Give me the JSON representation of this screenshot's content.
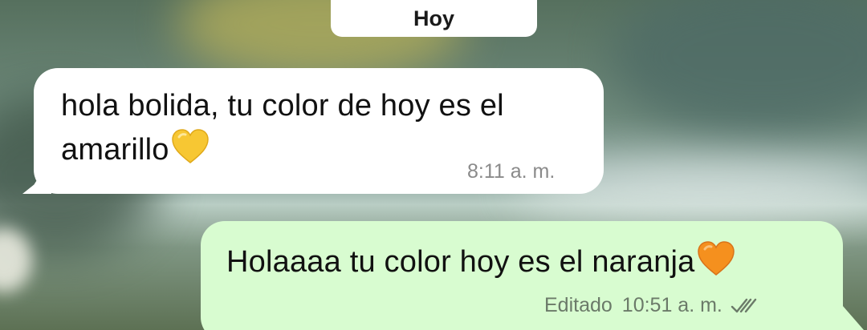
{
  "date_chip": {
    "label": "Hoy"
  },
  "messages": [
    {
      "direction": "incoming",
      "text_line1": "hola bolida, tu color de hoy es el",
      "text_line2": "amarillo",
      "emoji": "yellow-heart",
      "time": "8:11 a. m."
    },
    {
      "direction": "outgoing",
      "text": "Holaaaa tu color hoy es el naranja",
      "emoji": "orange-heart",
      "edited_label": "Editado",
      "time": "10:51 a. m.",
      "status_icon": "double-check-icon"
    }
  ],
  "colors": {
    "incoming_bubble": "#ffffff",
    "outgoing_bubble": "#d8fcd0",
    "yellow_heart": "#f7c733",
    "orange_heart": "#f5901e",
    "meta_text": "#8a8a8a"
  }
}
